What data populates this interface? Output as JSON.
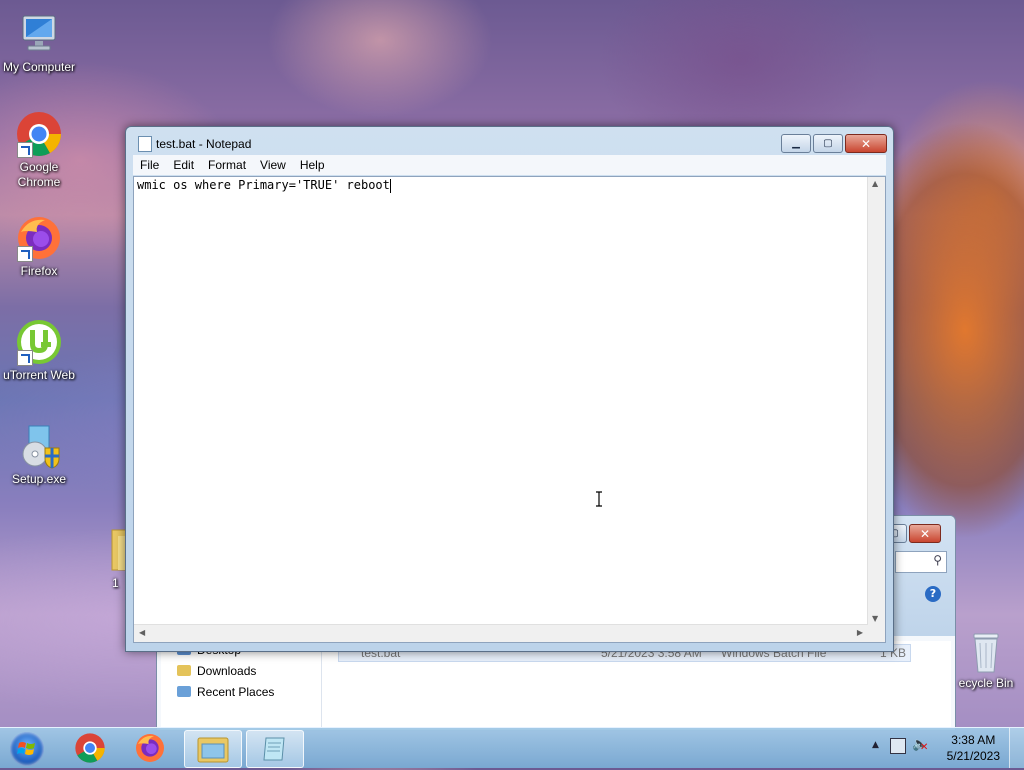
{
  "desktop": {
    "icons": [
      {
        "label": "My Computer"
      },
      {
        "label": "Google Chrome"
      },
      {
        "label": "Firefox"
      },
      {
        "label": "uTorrent Web"
      },
      {
        "label": "Setup.exe"
      },
      {
        "label": "1"
      },
      {
        "label": "ecycle Bin"
      }
    ]
  },
  "notepad": {
    "title": "test.bat - Notepad",
    "menu": [
      "File",
      "Edit",
      "Format",
      "View",
      "Help"
    ],
    "content": "wmic os where Primary='TRUE' reboot",
    "buttons": {
      "minimize": "▁",
      "maximize": "▢",
      "close": "✕"
    }
  },
  "explorer": {
    "nav": [
      "Desktop",
      "Downloads",
      "Recent Places"
    ],
    "file": {
      "name": "test.bat",
      "date": "5/21/2023 3:58 AM",
      "type": "Windows Batch File",
      "size": "1 KB"
    },
    "help_label": "?"
  },
  "taskbar": {
    "time": "3:38 AM",
    "date": "5/21/2023"
  }
}
